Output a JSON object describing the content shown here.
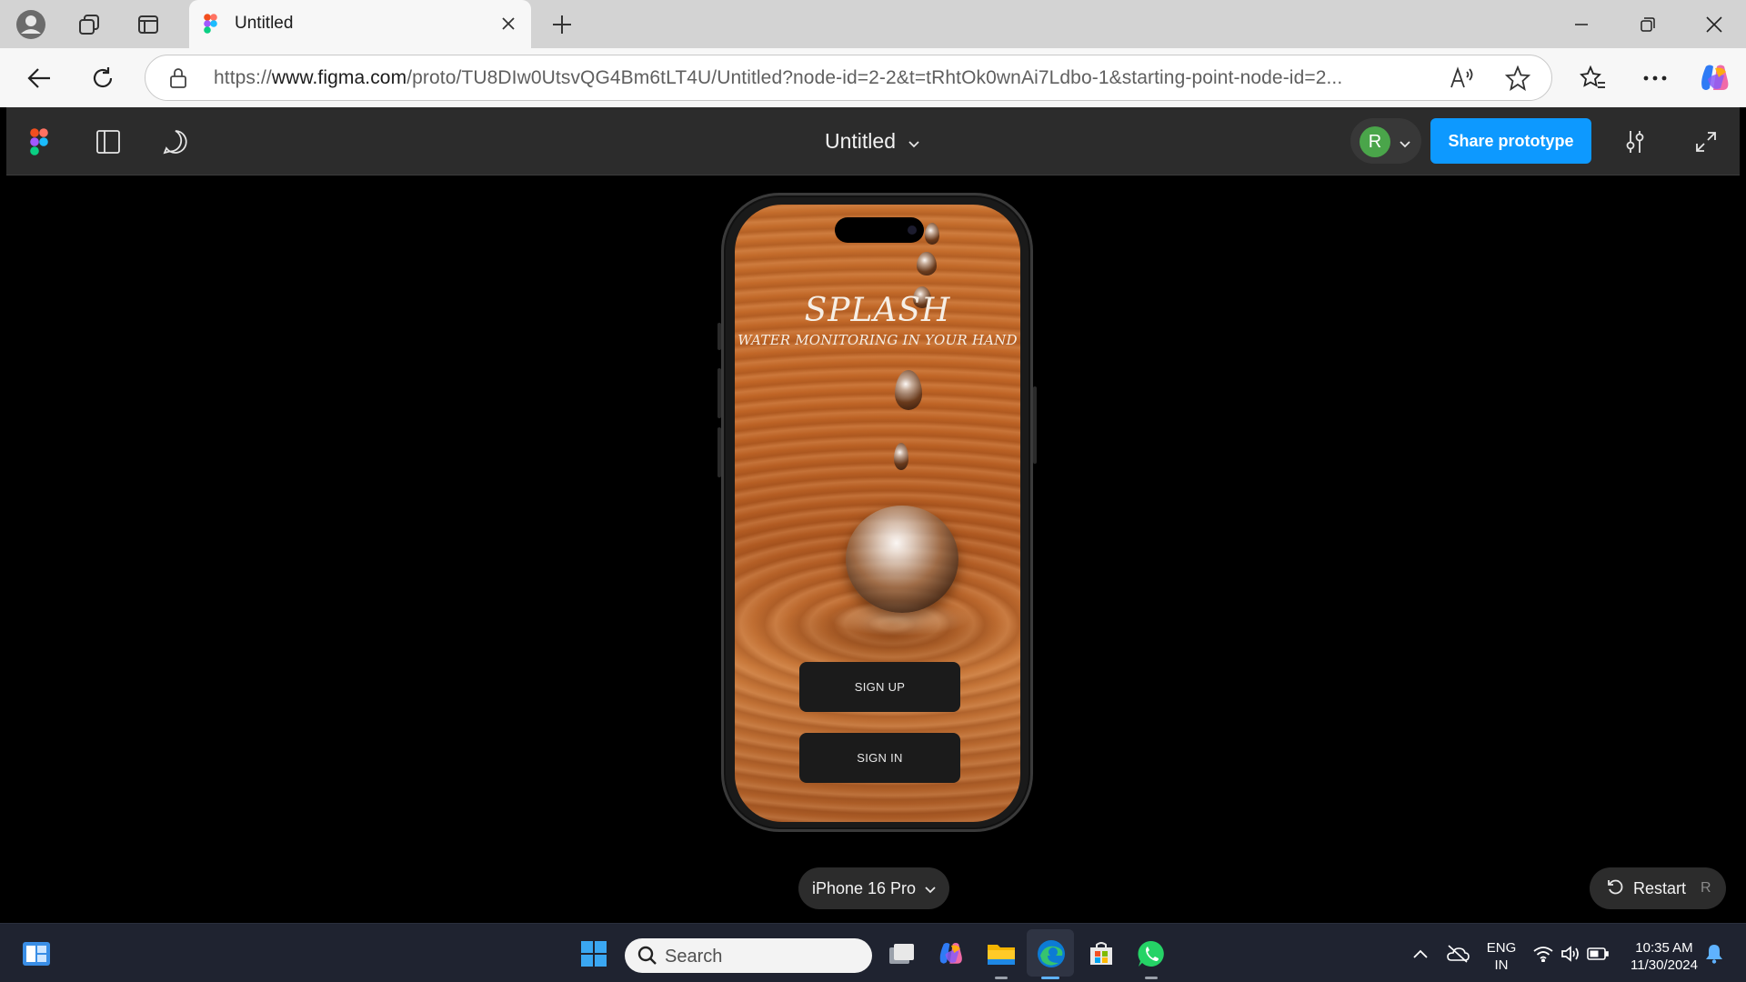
{
  "browser": {
    "tab_title": "Untitled",
    "url_scheme": "https://",
    "url_host": "www.figma.com",
    "url_path": "/proto/TU8DIw0UtsvQG4Bm6tLT4U/Untitled?node-id=2-2&t=tRhtOk0wnAi7Ldbo-1&starting-point-node-id=2...",
    "icons": [
      "profile-icon",
      "workspaces-icon",
      "tab-actions-icon",
      "figma-logo-icon",
      "close-icon",
      "new-tab-icon",
      "minimize-icon",
      "restore-icon",
      "close-window-icon",
      "back-icon",
      "refresh-icon",
      "lock-icon",
      "read-aloud-icon",
      "favorite-star-icon",
      "favorites-icon",
      "more-icon",
      "copilot-icon"
    ]
  },
  "figma": {
    "file_title": "Untitled",
    "avatar_initial": "R",
    "share_label": "Share prototype",
    "device_label": "iPhone 16 Pro",
    "restart_label": "Restart",
    "restart_key": "R",
    "colors": {
      "share": "#0d99ff",
      "avatar": "#4aa54a",
      "toolbar": "#2c2c2c"
    }
  },
  "app": {
    "title": "SPLASH",
    "subtitle": "WATER MONITORING IN YOUR HAND",
    "signup_label": "SIGN UP",
    "signin_label": "SIGN IN"
  },
  "taskbar": {
    "search_label": "Search",
    "lang_line1": "ENG",
    "lang_line2": "IN",
    "time": "10:35 AM",
    "date": "11/30/2024"
  }
}
